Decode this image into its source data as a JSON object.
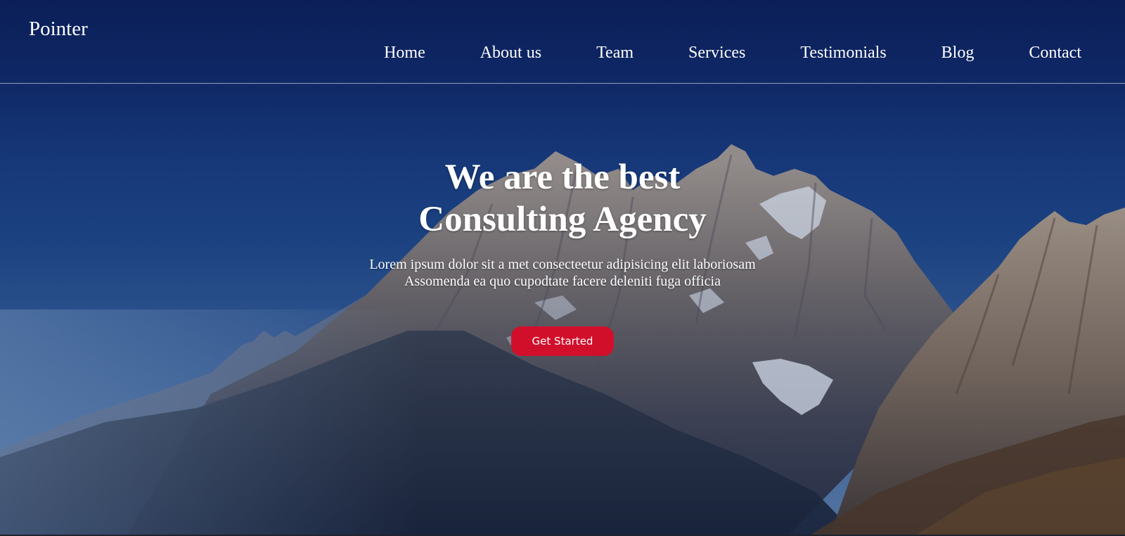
{
  "navbar": {
    "brand": "Pointer",
    "links": [
      "Home",
      "About us",
      "Team",
      "Services",
      "Testimonials",
      "Blog",
      "Contact"
    ]
  },
  "hero": {
    "headline_line1": "We are the best",
    "headline_line2": "Consulting Agency",
    "lead_line1": "Lorem ipsum dolor sit a met consecteetur adipisicing elit laboriosam",
    "lead_line2": "Assomenda ea quo cupodtate facere deleniti fuga officia",
    "cta_label": "Get Started"
  },
  "colors": {
    "accent": "#d10f2b",
    "text": "#ffffff",
    "sky_dark": "#0d2a6e",
    "sky_light": "#3d6aa6"
  }
}
